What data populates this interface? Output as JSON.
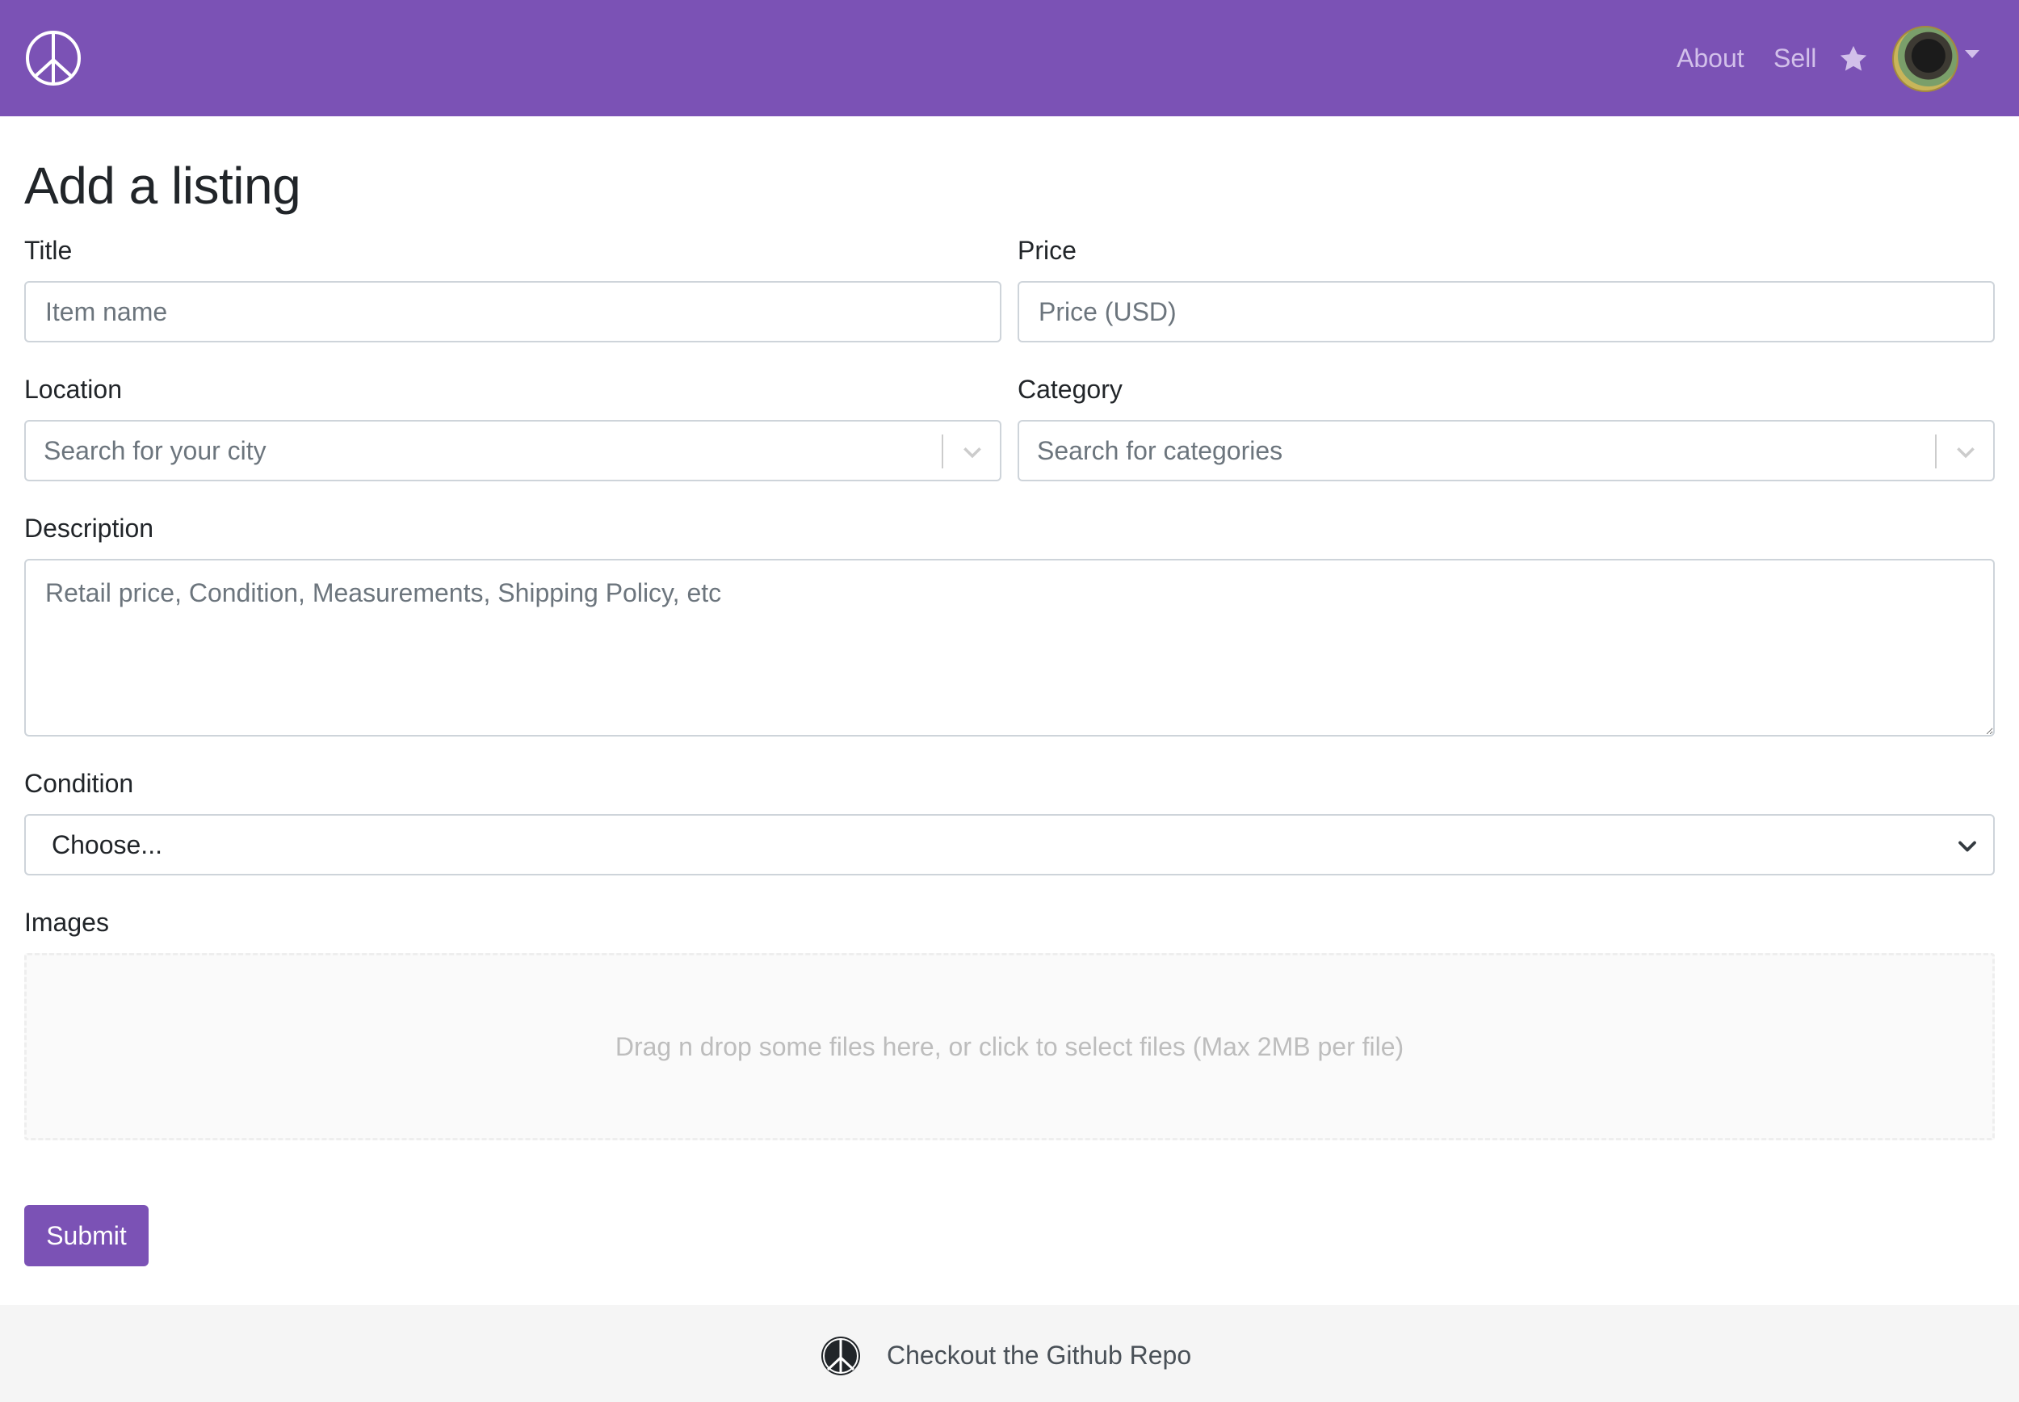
{
  "navbar": {
    "logo_icon": "peace-sign-icon",
    "links": [
      "About",
      "Sell"
    ],
    "favorites_icon": "star-icon",
    "avatar_icon": "user-avatar",
    "menu_icon": "caret-down-icon",
    "accent_color": "#7b52b5"
  },
  "page": {
    "title": "Add a listing"
  },
  "form": {
    "title_label": "Title",
    "title_placeholder": "Item name",
    "price_label": "Price",
    "price_placeholder": "Price (USD)",
    "location_label": "Location",
    "location_placeholder": "Search for your city",
    "category_label": "Category",
    "category_placeholder": "Search for categories",
    "description_label": "Description",
    "description_placeholder": "Retail price, Condition, Measurements, Shipping Policy, etc",
    "condition_label": "Condition",
    "condition_selected": "Choose...",
    "images_label": "Images",
    "dropzone_text": "Drag n drop some files here, or click to select files (Max 2MB per file)",
    "submit_label": "Submit"
  },
  "footer": {
    "logo_icon": "peace-sign-icon",
    "link_text": "Checkout the Github Repo"
  }
}
